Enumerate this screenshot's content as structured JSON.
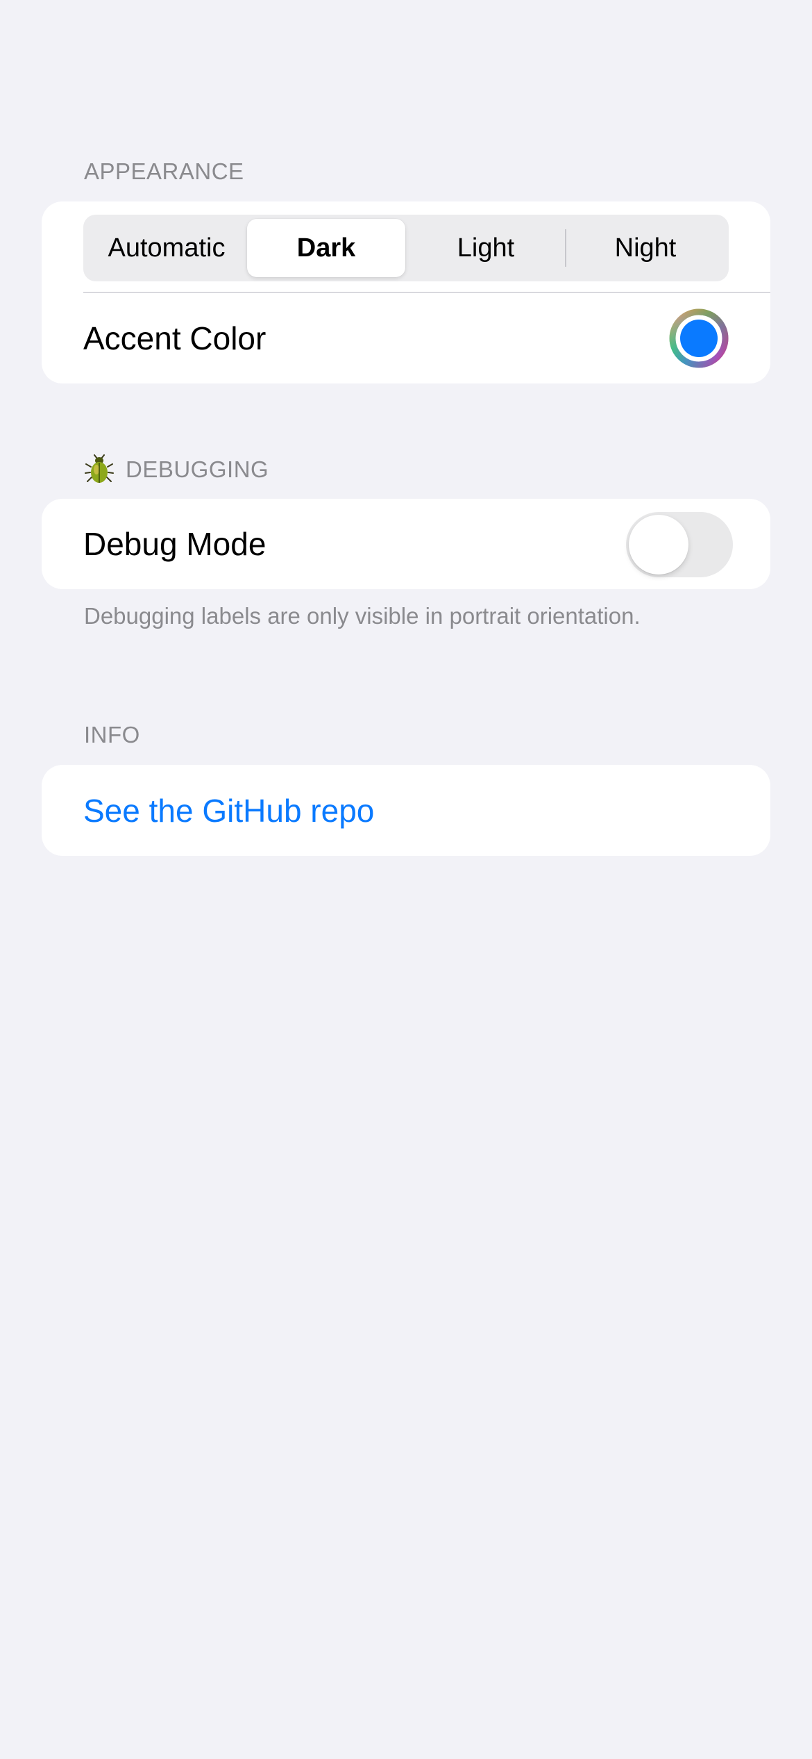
{
  "appearance": {
    "header": "APPEARANCE",
    "segments": [
      "Automatic",
      "Dark",
      "Light",
      "Night"
    ],
    "selected_segment": "Dark",
    "accent_label": "Accent Color",
    "accent_color": "#0a7aff"
  },
  "debugging": {
    "header_icon": "beetle-icon",
    "header": "DEBUGGING",
    "debug_mode_label": "Debug Mode",
    "debug_mode_on": false,
    "footer": "Debugging labels are only visible in portrait orientation."
  },
  "info": {
    "header": "INFO",
    "github_link": "See the GitHub repo"
  },
  "colors": {
    "background": "#f2f2f7",
    "card": "#ffffff",
    "secondary_text": "#8a8a8e",
    "link": "#0a7aff"
  }
}
